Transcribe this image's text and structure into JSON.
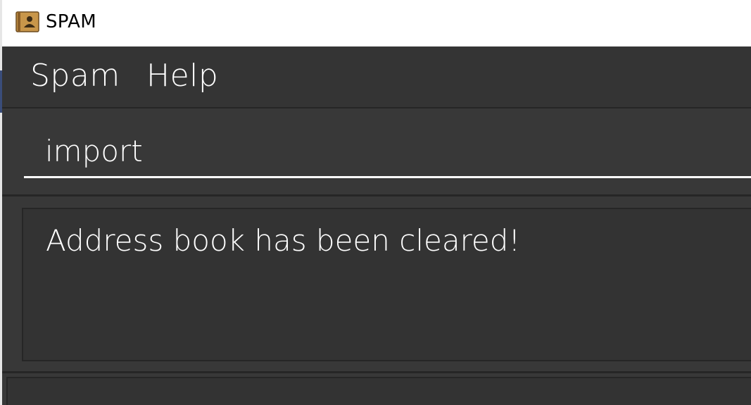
{
  "window": {
    "title": "SPAM",
    "icon": "address-book-icon"
  },
  "menu": {
    "items": [
      {
        "label": "Spam"
      },
      {
        "label": "Help"
      }
    ]
  },
  "command": {
    "value": "import"
  },
  "result": {
    "message": "Address book has been cleared!"
  },
  "colors": {
    "background": "#333333",
    "panel": "#383838",
    "border": "#262626",
    "text": "#ffffff",
    "icon_bg": "#c8964a"
  }
}
